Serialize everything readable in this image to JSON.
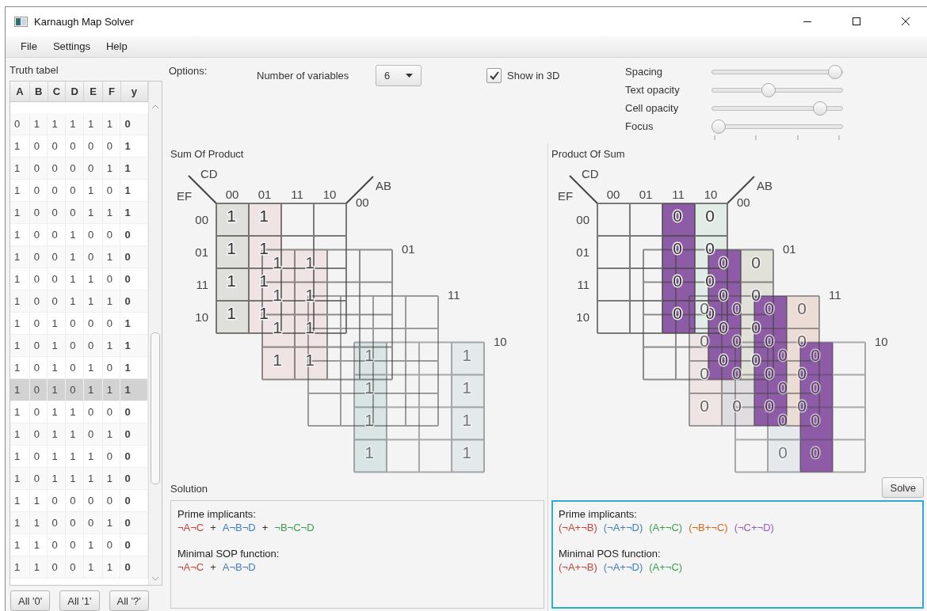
{
  "window": {
    "title": "Karnaugh Map Solver"
  },
  "menu": [
    {
      "label": "File"
    },
    {
      "label": "Settings"
    },
    {
      "label": "Help"
    }
  ],
  "truth_table": {
    "title": "Truth tabel",
    "columns": [
      "A",
      "B",
      "C",
      "D",
      "E",
      "F",
      "y"
    ],
    "rows": [
      {
        "values": [
          "0",
          "1",
          "1",
          "1",
          "1",
          "1",
          "0"
        ],
        "selected": false
      },
      {
        "values": [
          "1",
          "0",
          "0",
          "0",
          "0",
          "0",
          "1"
        ],
        "selected": false
      },
      {
        "values": [
          "1",
          "0",
          "0",
          "0",
          "0",
          "1",
          "1"
        ],
        "selected": false
      },
      {
        "values": [
          "1",
          "0",
          "0",
          "0",
          "1",
          "0",
          "1"
        ],
        "selected": false
      },
      {
        "values": [
          "1",
          "0",
          "0",
          "0",
          "1",
          "1",
          "1"
        ],
        "selected": false
      },
      {
        "values": [
          "1",
          "0",
          "0",
          "1",
          "0",
          "0",
          "0"
        ],
        "selected": false
      },
      {
        "values": [
          "1",
          "0",
          "0",
          "1",
          "0",
          "1",
          "0"
        ],
        "selected": false
      },
      {
        "values": [
          "1",
          "0",
          "0",
          "1",
          "1",
          "0",
          "0"
        ],
        "selected": false
      },
      {
        "values": [
          "1",
          "0",
          "0",
          "1",
          "1",
          "1",
          "0"
        ],
        "selected": false
      },
      {
        "values": [
          "1",
          "0",
          "1",
          "0",
          "0",
          "0",
          "1"
        ],
        "selected": false
      },
      {
        "values": [
          "1",
          "0",
          "1",
          "0",
          "0",
          "1",
          "1"
        ],
        "selected": false
      },
      {
        "values": [
          "1",
          "0",
          "1",
          "0",
          "1",
          "0",
          "1"
        ],
        "selected": false
      },
      {
        "values": [
          "1",
          "0",
          "1",
          "0",
          "1",
          "1",
          "1"
        ],
        "selected": true
      },
      {
        "values": [
          "1",
          "0",
          "1",
          "1",
          "0",
          "0",
          "0"
        ],
        "selected": false
      },
      {
        "values": [
          "1",
          "0",
          "1",
          "1",
          "0",
          "1",
          "0"
        ],
        "selected": false
      },
      {
        "values": [
          "1",
          "0",
          "1",
          "1",
          "1",
          "0",
          "0"
        ],
        "selected": false
      },
      {
        "values": [
          "1",
          "0",
          "1",
          "1",
          "1",
          "1",
          "0"
        ],
        "selected": false
      },
      {
        "values": [
          "1",
          "1",
          "0",
          "0",
          "0",
          "0",
          "0"
        ],
        "selected": false
      },
      {
        "values": [
          "1",
          "1",
          "0",
          "0",
          "0",
          "1",
          "0"
        ],
        "selected": false
      },
      {
        "values": [
          "1",
          "1",
          "0",
          "0",
          "1",
          "0",
          "0"
        ],
        "selected": false
      },
      {
        "values": [
          "1",
          "1",
          "0",
          "0",
          "1",
          "1",
          "0"
        ],
        "selected": false
      }
    ],
    "buttons": [
      "All '0'",
      "All '1'",
      "All '?'"
    ]
  },
  "options": {
    "title": "Options:",
    "variables": {
      "label": "Number of variables",
      "value": "6"
    },
    "show_3d": {
      "label": "Show in 3D",
      "checked": true
    },
    "sliders": [
      {
        "label": "Spacing",
        "level": 0.98,
        "ticks": false
      },
      {
        "label": "Text opacity",
        "level": 0.42,
        "ticks": false
      },
      {
        "label": "Cell opacity",
        "level": 0.85,
        "ticks": false
      },
      {
        "label": "Focus",
        "level": 0,
        "ticks": true
      }
    ]
  },
  "maps": [
    {
      "title": "Sum Of Product",
      "row_var": "EF",
      "col_var": "CD",
      "layer_var": "AB",
      "col_labels": [
        "00",
        "01",
        "11",
        "10"
      ],
      "row_labels": [
        "00",
        "01",
        "11",
        "10"
      ],
      "layers": [
        {
          "label": "00",
          "columns": [
            {
              "color": "#dfe0dc",
              "cells": [
                "1",
                "1",
                "1",
                "1"
              ]
            },
            {
              "color": "#efe3e3",
              "cells": [
                "1",
                "1",
                "1",
                "1"
              ]
            },
            null,
            null
          ]
        },
        {
          "label": "01",
          "columns": [
            {
              "color": "#efe3e3",
              "cells": [
                "1",
                "1",
                "1",
                "1"
              ]
            },
            {
              "color": "#efe3e3",
              "cells": [
                "1",
                "1",
                "1",
                "1"
              ]
            },
            null,
            null
          ]
        },
        {
          "label": "11",
          "columns": [
            null,
            null,
            null,
            null
          ]
        },
        {
          "label": "10",
          "columns": [
            {
              "color": "#d8e5e4",
              "cells": [
                "1",
                "1",
                "1",
                "1"
              ]
            },
            null,
            null,
            {
              "color": "#e4e9ec",
              "cells": [
                "1",
                "1",
                "1",
                "1"
              ]
            }
          ]
        }
      ]
    },
    {
      "title": "Product Of Sum",
      "row_var": "EF",
      "col_var": "CD",
      "layer_var": "AB",
      "col_labels": [
        "00",
        "01",
        "11",
        "10"
      ],
      "row_labels": [
        "00",
        "01",
        "11",
        "10"
      ],
      "layers": [
        {
          "label": "00",
          "columns": [
            null,
            null,
            {
              "color": "#8e5ba6",
              "cells": [
                "0",
                "0",
                "0",
                "0"
              ]
            },
            {
              "color": "#e2ece6",
              "cells": [
                "0",
                "0",
                "0",
                "0"
              ]
            }
          ]
        },
        {
          "label": "01",
          "columns": [
            null,
            null,
            {
              "color": "#8e5ba6",
              "cells": [
                "0",
                "0",
                "0",
                "0"
              ]
            },
            {
              "color": "#e1e1da",
              "cells": [
                "0",
                "0",
                "0",
                "0"
              ]
            }
          ]
        },
        {
          "label": "11",
          "columns": [
            {
              "color": "#efe4e4",
              "cells": [
                "0",
                "0",
                "0",
                "0"
              ]
            },
            {
              "color": "#e0dde0",
              "cells": [
                "0",
                "0",
                "0",
                "0"
              ]
            },
            {
              "color": "#8e5ba6",
              "cells": [
                "0",
                "0",
                "0",
                "0"
              ]
            },
            {
              "color": "#ecdcd6",
              "cells": [
                "0",
                "0",
                "0",
                "0"
              ]
            }
          ]
        },
        {
          "label": "10",
          "columns": [
            null,
            {
              "color": "#e5e9ec",
              "cells": [
                "0",
                "0",
                "0",
                "0"
              ]
            },
            {
              "color": "#8e5ba6",
              "cells": [
                "0",
                "0",
                "0",
                "0"
              ]
            },
            null
          ]
        }
      ]
    }
  ],
  "solution": {
    "title": "Solution",
    "solve_button": "Solve",
    "panels": [
      {
        "focused": false,
        "separator": "+",
        "sections": [
          {
            "heading": "Prime implicants:",
            "terms": [
              {
                "text": "¬A¬C",
                "color": "#c0463c"
              },
              {
                "text": "A¬B¬D",
                "color": "#3d7fc0"
              },
              {
                "text": "¬B¬C¬D",
                "color": "#3a9f4e"
              }
            ]
          },
          {
            "heading": "Minimal SOP function:",
            "terms": [
              {
                "text": "¬A¬C",
                "color": "#c0463c"
              },
              {
                "text": "A¬B¬D",
                "color": "#3d7fc0"
              }
            ]
          }
        ]
      },
      {
        "focused": true,
        "sections": [
          {
            "heading": "Prime implicants:",
            "terms": [
              {
                "text": "(¬A+¬B)",
                "color": "#c0463c"
              },
              {
                "text": "(¬A+¬D)",
                "color": "#3d7fc0"
              },
              {
                "text": "(A+¬C)",
                "color": "#3a9f4e"
              },
              {
                "text": "(¬B+¬C)",
                "color": "#d2691e"
              },
              {
                "text": "(¬C+¬D)",
                "color": "#9b59c0"
              }
            ]
          },
          {
            "heading": "Minimal POS function:",
            "terms": [
              {
                "text": "(¬A+¬B)",
                "color": "#c0463c"
              },
              {
                "text": "(¬A+¬D)",
                "color": "#3d7fc0"
              },
              {
                "text": "(A+¬C)",
                "color": "#3a9f4e"
              }
            ]
          }
        ]
      }
    ]
  }
}
